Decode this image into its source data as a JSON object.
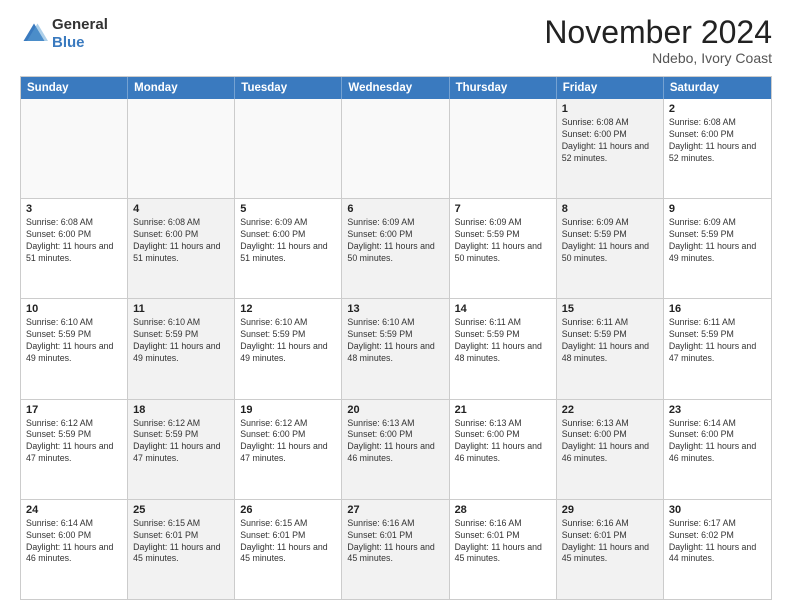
{
  "header": {
    "logo_general": "General",
    "logo_blue": "Blue",
    "month_title": "November 2024",
    "location": "Ndebo, Ivory Coast"
  },
  "days_of_week": [
    "Sunday",
    "Monday",
    "Tuesday",
    "Wednesday",
    "Thursday",
    "Friday",
    "Saturday"
  ],
  "rows": [
    [
      {
        "day": "",
        "empty": true
      },
      {
        "day": "",
        "empty": true
      },
      {
        "day": "",
        "empty": true
      },
      {
        "day": "",
        "empty": true
      },
      {
        "day": "",
        "empty": true
      },
      {
        "day": "1",
        "sunrise": "6:08 AM",
        "sunset": "6:00 PM",
        "daylight": "11 hours and 52 minutes."
      },
      {
        "day": "2",
        "sunrise": "6:08 AM",
        "sunset": "6:00 PM",
        "daylight": "11 hours and 52 minutes."
      }
    ],
    [
      {
        "day": "3",
        "sunrise": "6:08 AM",
        "sunset": "6:00 PM",
        "daylight": "11 hours and 51 minutes."
      },
      {
        "day": "4",
        "sunrise": "6:08 AM",
        "sunset": "6:00 PM",
        "daylight": "11 hours and 51 minutes."
      },
      {
        "day": "5",
        "sunrise": "6:09 AM",
        "sunset": "6:00 PM",
        "daylight": "11 hours and 51 minutes."
      },
      {
        "day": "6",
        "sunrise": "6:09 AM",
        "sunset": "6:00 PM",
        "daylight": "11 hours and 50 minutes."
      },
      {
        "day": "7",
        "sunrise": "6:09 AM",
        "sunset": "5:59 PM",
        "daylight": "11 hours and 50 minutes."
      },
      {
        "day": "8",
        "sunrise": "6:09 AM",
        "sunset": "5:59 PM",
        "daylight": "11 hours and 50 minutes."
      },
      {
        "day": "9",
        "sunrise": "6:09 AM",
        "sunset": "5:59 PM",
        "daylight": "11 hours and 49 minutes."
      }
    ],
    [
      {
        "day": "10",
        "sunrise": "6:10 AM",
        "sunset": "5:59 PM",
        "daylight": "11 hours and 49 minutes."
      },
      {
        "day": "11",
        "sunrise": "6:10 AM",
        "sunset": "5:59 PM",
        "daylight": "11 hours and 49 minutes."
      },
      {
        "day": "12",
        "sunrise": "6:10 AM",
        "sunset": "5:59 PM",
        "daylight": "11 hours and 49 minutes."
      },
      {
        "day": "13",
        "sunrise": "6:10 AM",
        "sunset": "5:59 PM",
        "daylight": "11 hours and 48 minutes."
      },
      {
        "day": "14",
        "sunrise": "6:11 AM",
        "sunset": "5:59 PM",
        "daylight": "11 hours and 48 minutes."
      },
      {
        "day": "15",
        "sunrise": "6:11 AM",
        "sunset": "5:59 PM",
        "daylight": "11 hours and 48 minutes."
      },
      {
        "day": "16",
        "sunrise": "6:11 AM",
        "sunset": "5:59 PM",
        "daylight": "11 hours and 47 minutes."
      }
    ],
    [
      {
        "day": "17",
        "sunrise": "6:12 AM",
        "sunset": "5:59 PM",
        "daylight": "11 hours and 47 minutes."
      },
      {
        "day": "18",
        "sunrise": "6:12 AM",
        "sunset": "5:59 PM",
        "daylight": "11 hours and 47 minutes."
      },
      {
        "day": "19",
        "sunrise": "6:12 AM",
        "sunset": "6:00 PM",
        "daylight": "11 hours and 47 minutes."
      },
      {
        "day": "20",
        "sunrise": "6:13 AM",
        "sunset": "6:00 PM",
        "daylight": "11 hours and 46 minutes."
      },
      {
        "day": "21",
        "sunrise": "6:13 AM",
        "sunset": "6:00 PM",
        "daylight": "11 hours and 46 minutes."
      },
      {
        "day": "22",
        "sunrise": "6:13 AM",
        "sunset": "6:00 PM",
        "daylight": "11 hours and 46 minutes."
      },
      {
        "day": "23",
        "sunrise": "6:14 AM",
        "sunset": "6:00 PM",
        "daylight": "11 hours and 46 minutes."
      }
    ],
    [
      {
        "day": "24",
        "sunrise": "6:14 AM",
        "sunset": "6:00 PM",
        "daylight": "11 hours and 46 minutes."
      },
      {
        "day": "25",
        "sunrise": "6:15 AM",
        "sunset": "6:01 PM",
        "daylight": "11 hours and 45 minutes."
      },
      {
        "day": "26",
        "sunrise": "6:15 AM",
        "sunset": "6:01 PM",
        "daylight": "11 hours and 45 minutes."
      },
      {
        "day": "27",
        "sunrise": "6:16 AM",
        "sunset": "6:01 PM",
        "daylight": "11 hours and 45 minutes."
      },
      {
        "day": "28",
        "sunrise": "6:16 AM",
        "sunset": "6:01 PM",
        "daylight": "11 hours and 45 minutes."
      },
      {
        "day": "29",
        "sunrise": "6:16 AM",
        "sunset": "6:01 PM",
        "daylight": "11 hours and 45 minutes."
      },
      {
        "day": "30",
        "sunrise": "6:17 AM",
        "sunset": "6:02 PM",
        "daylight": "11 hours and 44 minutes."
      }
    ]
  ]
}
